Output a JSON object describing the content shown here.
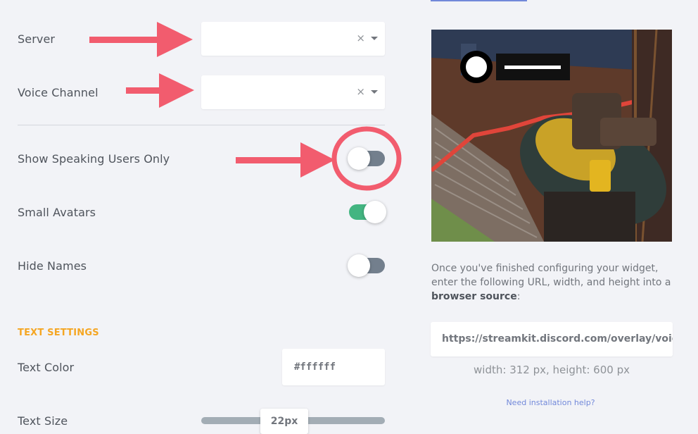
{
  "form": {
    "server": {
      "label": "Server",
      "value": "",
      "clear_icon": "×"
    },
    "voice_channel": {
      "label": "Voice Channel",
      "value": "",
      "clear_icon": "×"
    },
    "toggles": [
      {
        "label": "Show Speaking Users Only",
        "state": "off"
      },
      {
        "label": "Small Avatars",
        "state": "on"
      },
      {
        "label": "Hide Names",
        "state": "off"
      }
    ],
    "text_settings": {
      "heading": "TEXT SETTINGS",
      "text_color_label": "Text Color",
      "text_color_value": "#ffffff",
      "text_size_label": "Text Size",
      "text_size_value": "22px"
    }
  },
  "sidebar": {
    "instructions_before": "Once you've finished configuring your widget, enter the following URL, width, and height into a ",
    "instructions_bold": "browser source",
    "instructions_after": ":",
    "url": "https://streamkit.discord.com/overlay/voice",
    "dimensions": "width: 312 px, height: 600 px",
    "help_link": "Need installation help?"
  },
  "colors": {
    "accent_orange": "#f5a623",
    "annotation_red": "#f25c6e",
    "toggle_on": "#43b581",
    "toggle_off": "#737f8d",
    "link": "#7289da"
  }
}
